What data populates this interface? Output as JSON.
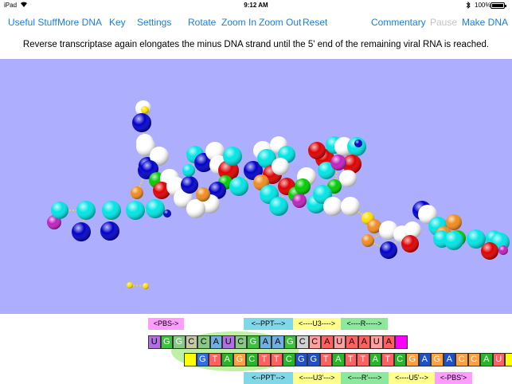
{
  "status": {
    "carrier": "iPad",
    "time": "9:12 AM",
    "battery": "100%"
  },
  "toolbar": {
    "useful_stuff": "Useful Stuff",
    "more_dna": "More DNA",
    "key": "Key",
    "settings": "Settings",
    "rotate": "Rotate",
    "zoom_in": "Zoom In",
    "zoom_out": "Zoom Out",
    "reset": "Reset",
    "commentary": "Commentary",
    "pause": "Pause",
    "make_dna": "Make DNA"
  },
  "caption": "Reverse transcriptase again elongates the minus DNA strand until the 5' end of the remaining viral RNA is reached.",
  "colors": {
    "toolbar_text": "#1a7fe0",
    "toolbar_disabled": "#c4c4c4",
    "viewer_background": "#aeaeff",
    "atom_cyan": "#00e5e5",
    "atom_blue": "#0000cc",
    "atom_red": "#e00000",
    "atom_white": "#ffffff",
    "atom_green": "#00cc00",
    "atom_orange": "#f08c1e",
    "atom_magenta": "#c020c0",
    "atom_yellow": "#ffe000"
  },
  "sequence": {
    "top_labels": [
      "<PBS->",
      "<--PPT--->",
      "<----U3---->",
      "<----R----->"
    ],
    "top_strand": [
      "U",
      "G",
      "G",
      "C",
      "C",
      "A",
      "U",
      "C",
      "G",
      "A",
      "A",
      "G",
      "C",
      "C",
      "A",
      "U",
      "A",
      "A",
      "U",
      "A",
      ""
    ],
    "bottom_strand": [
      "",
      "G",
      "T",
      "A",
      "G",
      "C",
      "T",
      "T",
      "C",
      "G",
      "G",
      "T",
      "A",
      "T",
      "T",
      "A",
      "T",
      "C",
      "G",
      "A",
      "G",
      "A",
      "C",
      "C",
      "A",
      "U",
      ""
    ],
    "bottom_labels": [
      "<--PPT'-->",
      "<----U3'--->",
      "<----R'---->",
      "<----U5'-->",
      "<-PBS'>"
    ]
  }
}
